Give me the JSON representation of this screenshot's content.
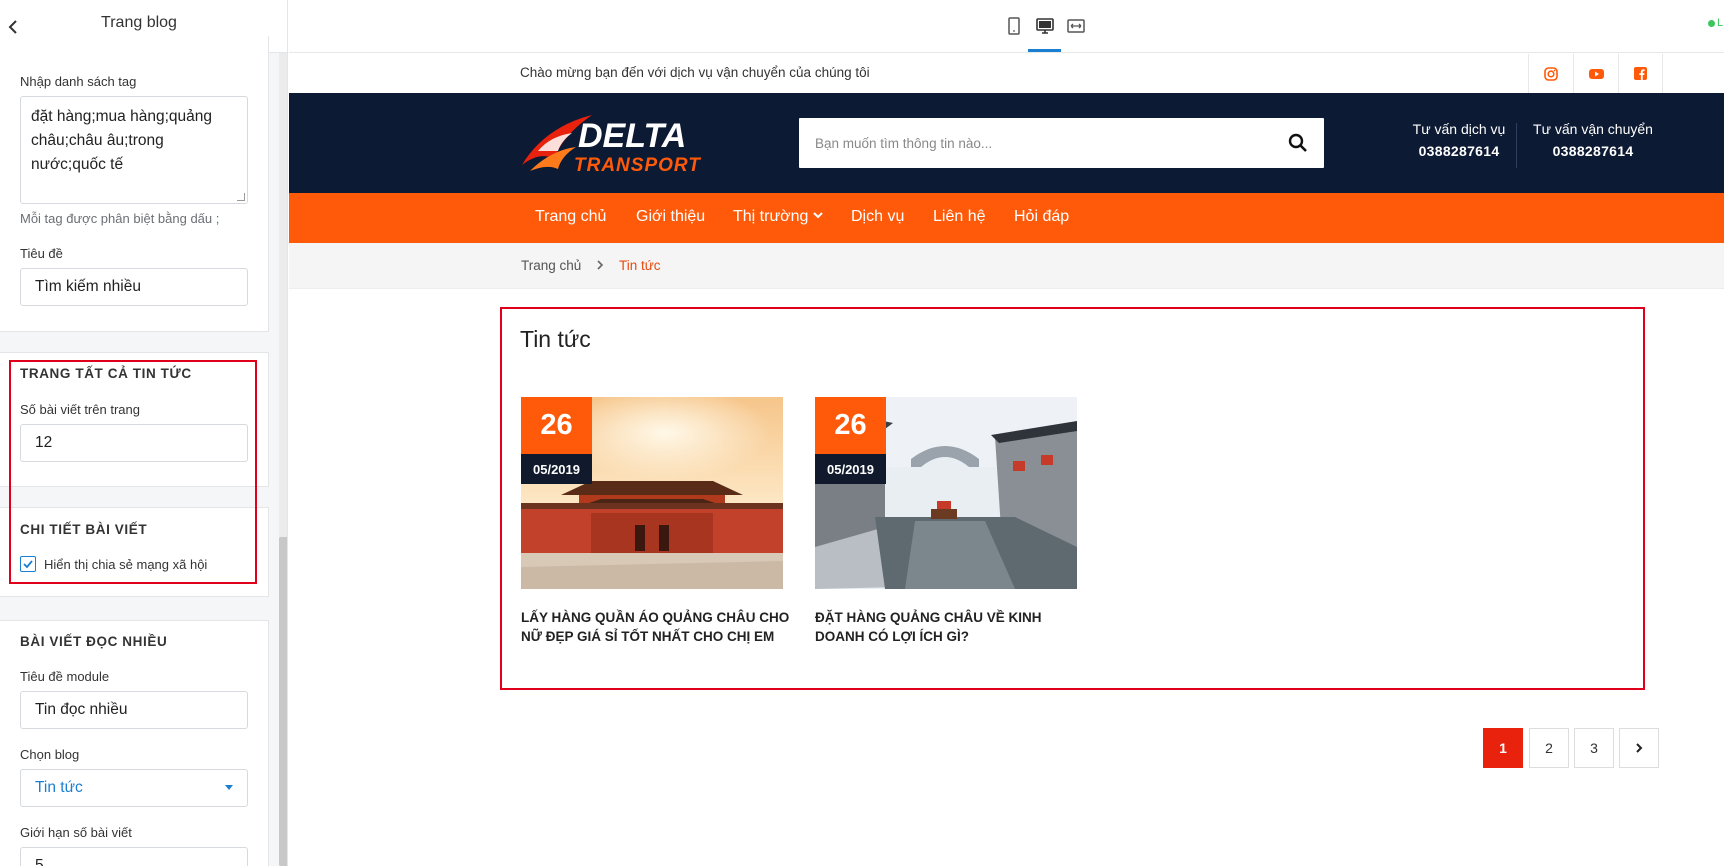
{
  "panel": {
    "title": "Trang blog",
    "tags_label": "Nhập danh sách tag",
    "tags_value": "đặt hàng;mua hàng;quảng châu;châu âu;trong nước;quốc tế",
    "tags_hint": "Mỗi tag được phân biệt bằng dấu ;",
    "title_label": "Tiêu đề",
    "title_value": "Tìm kiếm nhiều",
    "all_news_section": "TRANG TẤT CẢ TIN TỨC",
    "posts_per_page_label": "Số bài viết trên trang",
    "posts_per_page_value": "12",
    "post_detail_section": "CHI TIẾT BÀI VIẾT",
    "share_checkbox_label": "Hiển thị chia sẻ mạng xã hội",
    "share_checked": true,
    "popular_section": "BÀI VIẾT ĐỌC NHIỀU",
    "module_title_label": "Tiêu đề module",
    "module_title_value": "Tin đọc nhiều",
    "blog_select_label": "Chọn blog",
    "blog_select_value": "Tin tức",
    "limit_label": "Giới hạn số bài viết",
    "limit_value": "5"
  },
  "device_bar": {
    "status_text": "L",
    "icons": [
      "tablet-icon",
      "desktop-icon",
      "fullwidth-icon"
    ],
    "active": "desktop-icon"
  },
  "site": {
    "welcome": "Chào mừng bạn đến với dịch vụ vận chuyển của chúng tôi",
    "social": [
      "instagram-icon",
      "youtube-icon",
      "facebook-icon"
    ],
    "logo_main": "DELTA",
    "logo_sub": "TRANSPORT",
    "search_placeholder": "Bạn muốn tìm thông tin nào...",
    "contacts": [
      {
        "label": "Tư vấn dịch vụ",
        "phone": "0388287614"
      },
      {
        "label": "Tư vấn vận chuyển",
        "phone": "0388287614"
      }
    ],
    "nav": [
      "Trang chủ",
      "Giới thiệu",
      "Thị trường",
      "Dịch vụ",
      "Liên hệ",
      "Hỏi đáp"
    ],
    "breadcrumb": {
      "home": "Trang chủ",
      "current": "Tin tức"
    },
    "heading": "Tin tức",
    "posts": [
      {
        "day": "26",
        "month": "05/2019",
        "title": "LẤY HÀNG QUẦN ÁO QUẢNG CHÂU CHO NỮ ĐẸP GIÁ SỈ TỐT NHẤT CHO CHỊ EM"
      },
      {
        "day": "26",
        "month": "05/2019",
        "title": "ĐẶT HÀNG QUẢNG CHÂU VỀ KINH DOANH CÓ LỢI ÍCH GÌ?"
      }
    ],
    "pagination": [
      "1",
      "2",
      "3"
    ],
    "active_page": "1"
  },
  "colors": {
    "brand_orange": "#ff5a0a",
    "header_navy": "#0d1a33",
    "highlight_red": "#e0001b",
    "accent_blue": "#1a7fd1"
  }
}
